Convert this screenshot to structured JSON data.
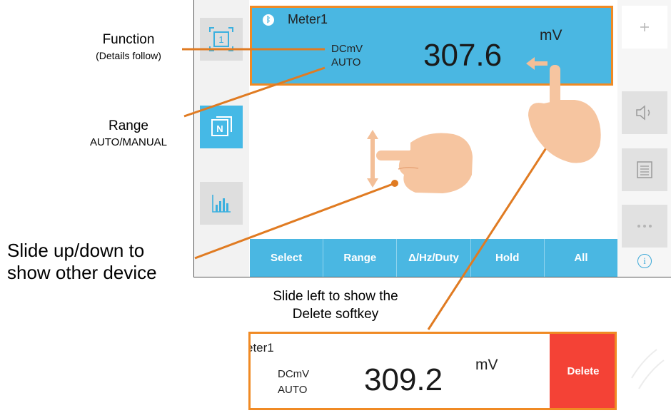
{
  "device": {
    "meter": {
      "name": "Meter1",
      "function": "DCmV",
      "range": "AUTO",
      "value": "307.6",
      "unit": "mV"
    },
    "softkeys": [
      "Select",
      "Range",
      "Δ/Hz/Duty",
      "Hold",
      "All"
    ],
    "left_sidebar_icons": [
      "frame-1-icon",
      "n-icon",
      "bar-chart-icon"
    ],
    "right_sidebar_icons": [
      "plus-icon",
      "speaker-icon",
      "list-icon",
      "more-icon",
      "info-icon"
    ],
    "info_symbol": "i"
  },
  "annotations": {
    "function": {
      "title": "Function",
      "subtitle": "(Details follow)"
    },
    "range": {
      "title": "Range",
      "subtitle": "AUTO/MANUAL"
    },
    "slide_updown": {
      "line1": "Slide up/down to",
      "line2": "show other device"
    },
    "slide_left": {
      "line1": "Slide left to show the",
      "line2": "Delete softkey"
    }
  },
  "delete_card": {
    "name": "eter1",
    "function": "DCmV",
    "range": "AUTO",
    "value": "309.2",
    "unit": "mV",
    "delete_label": "Delete"
  },
  "colors": {
    "accent_blue": "#4ab7e2",
    "callout_orange": "#f08a24",
    "delete_red": "#f44236"
  }
}
